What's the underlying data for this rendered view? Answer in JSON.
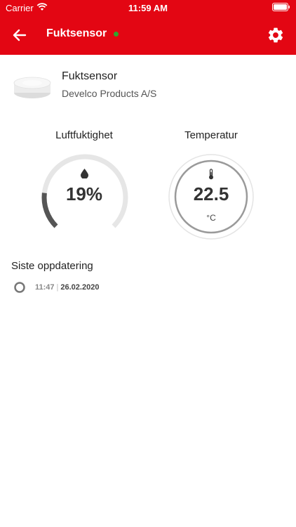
{
  "status_bar": {
    "carrier": "Carrier",
    "time": "11:59 AM"
  },
  "nav": {
    "title": "Fuktsensor",
    "online_color": "#2fa52f",
    "accent": "#e30613"
  },
  "device": {
    "name": "Fuktsensor",
    "manufacturer": "Develco Products A/S"
  },
  "humidity": {
    "label": "Luftfuktighet",
    "display": "19%",
    "percent": 19,
    "icon": "droplet-icon"
  },
  "temperature": {
    "label": "Temperatur",
    "display": "22.5",
    "unit": "°C",
    "icon": "thermometer-icon"
  },
  "last_update": {
    "title": "Siste oppdatering",
    "time": "11:47",
    "separator": "|",
    "date": "26.02.2020"
  }
}
